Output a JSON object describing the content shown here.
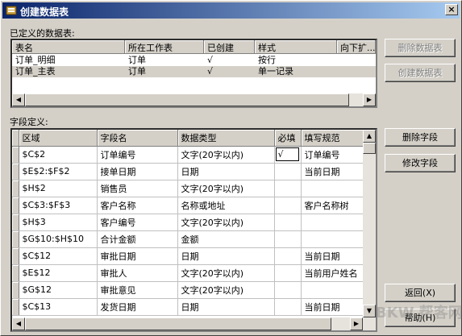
{
  "window": {
    "title": "创建数据表",
    "close_glyph": "×"
  },
  "defined_tables": {
    "label": "已定义的数据表:",
    "columns": [
      "表名",
      "所在工作表",
      "已创建",
      "样式",
      "向下扩..."
    ],
    "rows": [
      [
        "订单_明细",
        "订单",
        "√",
        "按行",
        ""
      ],
      [
        "订单_主表",
        "订单",
        "√",
        "单一记录",
        ""
      ]
    ]
  },
  "field_definition": {
    "label": "字段定义:",
    "columns": [
      "区域",
      "字段名",
      "数据类型",
      "必填",
      "填写规范"
    ],
    "rows": [
      [
        "$C$2",
        "订单编号",
        "文字(20字以内)",
        "√",
        "订单编号"
      ],
      [
        "$E$2:$F$2",
        "接单日期",
        "日期",
        "",
        "当前日期"
      ],
      [
        "$H$2",
        "销售员",
        "文字(20字以内)",
        "",
        ""
      ],
      [
        "$C$3:$F$3",
        "客户名称",
        "名称或地址",
        "",
        "客户名称树"
      ],
      [
        "$H$3",
        "客户编号",
        "文字(20字以内)",
        "",
        ""
      ],
      [
        "$G$10:$H$10",
        "合计金额",
        "金额",
        "",
        ""
      ],
      [
        "$C$12",
        "审批日期",
        "日期",
        "",
        "当前日期"
      ],
      [
        "$E$12",
        "审批人",
        "文字(20字以内)",
        "",
        "当前用户姓名"
      ],
      [
        "$G$12",
        "审批意见",
        "文字(20字以内)",
        "",
        ""
      ],
      [
        "$C$13",
        "发货日期",
        "日期",
        "",
        "当前日期"
      ]
    ]
  },
  "buttons": {
    "delete_table": "删除数据表",
    "create_table": "创建数据表",
    "delete_field": "删除字段",
    "modify_field": "修改字段",
    "back": "返回(X)",
    "help": "帮助(H)"
  },
  "watermark": "BKW 帮客网"
}
